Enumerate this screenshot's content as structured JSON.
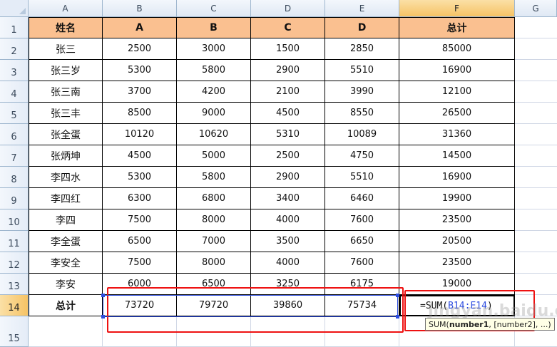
{
  "columns": [
    "A",
    "B",
    "C",
    "D",
    "E",
    "F",
    "G"
  ],
  "rows": [
    "1",
    "2",
    "3",
    "4",
    "5",
    "6",
    "7",
    "8",
    "9",
    "10",
    "11",
    "12",
    "13",
    "14",
    "15"
  ],
  "header": [
    "姓名",
    "A",
    "B",
    "C",
    "D",
    "总计"
  ],
  "data": [
    [
      "张三",
      "2500",
      "3000",
      "1500",
      "2850",
      "85000"
    ],
    [
      "张三岁",
      "5300",
      "5800",
      "2900",
      "5510",
      "16900"
    ],
    [
      "张三南",
      "3700",
      "4200",
      "2100",
      "3990",
      "12100"
    ],
    [
      "张三丰",
      "8500",
      "9000",
      "4500",
      "8550",
      "26500"
    ],
    [
      "张全蛋",
      "10120",
      "10620",
      "5310",
      "10089",
      "31360"
    ],
    [
      "张炳坤",
      "4500",
      "5000",
      "2500",
      "4750",
      "14500"
    ],
    [
      "李四水",
      "5300",
      "5800",
      "2900",
      "5510",
      "16900"
    ],
    [
      "李四红",
      "6300",
      "6800",
      "3400",
      "6460",
      "19900"
    ],
    [
      "李四",
      "7500",
      "8000",
      "4000",
      "7600",
      "23500"
    ],
    [
      "李全蛋",
      "6500",
      "7000",
      "3500",
      "6650",
      "20500"
    ],
    [
      "李安全",
      "7500",
      "8000",
      "4000",
      "7600",
      "23500"
    ],
    [
      "李安",
      "6000",
      "6500",
      "3250",
      "6175",
      "19000"
    ]
  ],
  "total_row": {
    "label": "总计",
    "values": [
      "73720",
      "79720",
      "39860",
      "75734"
    ]
  },
  "formula": {
    "prefix": "=SUM(",
    "ref": "B14:E14",
    "suffix": ")"
  },
  "tooltip": {
    "func": "SUM(",
    "arg1": "number1",
    "rest": ", [number2], ...)"
  },
  "watermark": "jingyan.baidu.com  经验",
  "colors": {
    "header_fill": "#fac090",
    "highlight_red": "#ee1111",
    "ref_blue": "#2d4de0"
  }
}
